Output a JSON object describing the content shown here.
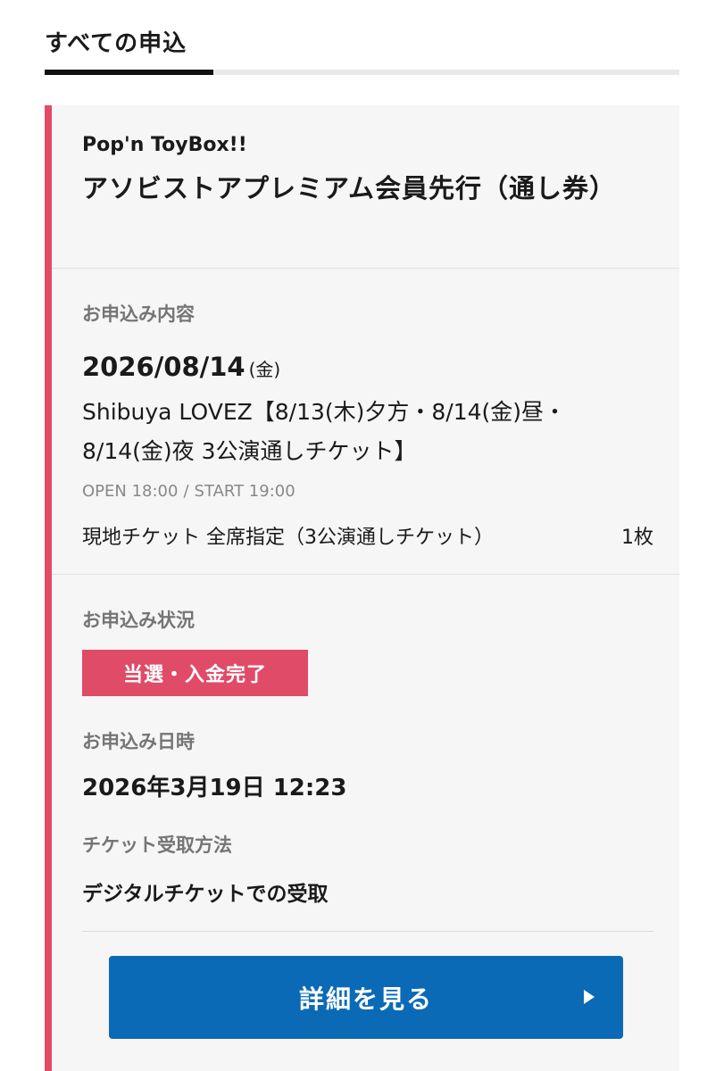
{
  "tabs": {
    "active_label": "すべての申込"
  },
  "entry": {
    "event_name": "Pop'n ToyBox!!",
    "ticket_title": "アソビストアプレミアム会員先行（通し券）",
    "details_section": {
      "label": "お申込み内容",
      "date": "2026/08/14",
      "day_of_week": "(金)",
      "performance_name": "Shibuya LOVEZ【8/13(木)夕方・8/14(金)昼・8/14(金)夜 3公演通しチケット】",
      "open_time": "OPEN 18:00",
      "time_separator": "/",
      "start_time": "START 19:00",
      "seat_type": "現地チケット 全席指定（3公演通しチケット）",
      "quantity": "1枚"
    },
    "status_section": {
      "label": "お申込み状況",
      "status": "当選・入金完了",
      "status_color": "#e04b68",
      "applied_label": "お申込み日時",
      "applied_at": "2026年3月19日 12:23",
      "pickup_label": "チケット受取方法",
      "pickup_method": "デジタルチケットでの受取"
    },
    "action": {
      "details_button_label": "詳細を見る",
      "icon": "play-arrow-icon"
    },
    "accent_color": "#e04b68",
    "button_color": "#0b6ab6"
  }
}
